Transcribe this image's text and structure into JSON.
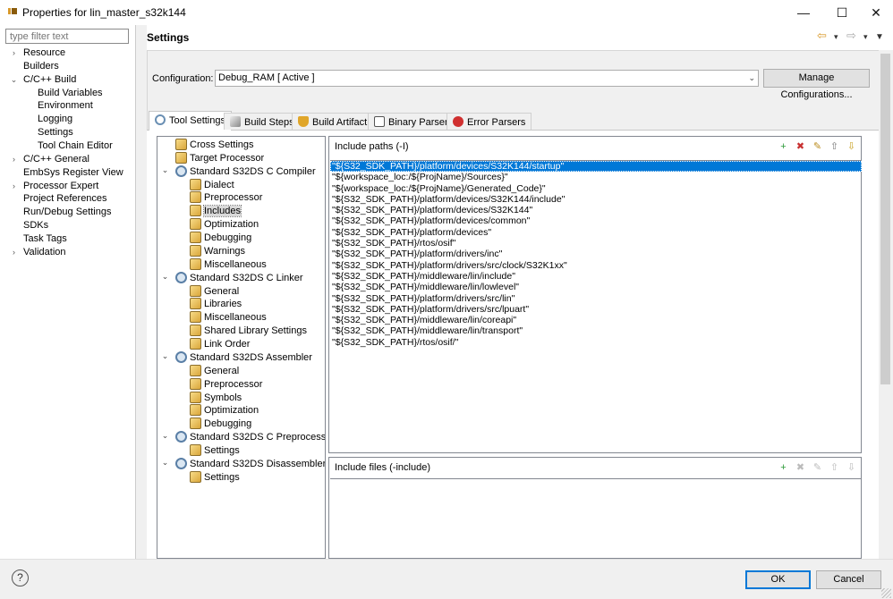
{
  "window": {
    "title": "Properties for lin_master_s32k144",
    "minimize": "—",
    "maximize": "☐",
    "close": "✕"
  },
  "filter": {
    "placeholder": "type filter text"
  },
  "nav": {
    "items": [
      {
        "label": "Resource",
        "expand": "›"
      },
      {
        "label": "Builders"
      },
      {
        "label": "C/C++ Build",
        "expand": "⌄"
      },
      {
        "label": "Build Variables"
      },
      {
        "label": "Environment"
      },
      {
        "label": "Logging"
      },
      {
        "label": "Settings"
      },
      {
        "label": "Tool Chain Editor"
      },
      {
        "label": "C/C++ General",
        "expand": "›"
      },
      {
        "label": "EmbSys Register View"
      },
      {
        "label": "Processor Expert",
        "expand": "›"
      },
      {
        "label": "Project References"
      },
      {
        "label": "Run/Debug Settings"
      },
      {
        "label": "SDKs"
      },
      {
        "label": "Task Tags"
      },
      {
        "label": "Validation",
        "expand": "›"
      }
    ]
  },
  "header": {
    "title": "Settings",
    "back": "⇦",
    "back_drop": "▾",
    "forward": "⇨",
    "forward_drop": "▾",
    "menu": "▼"
  },
  "config": {
    "label": "Configuration:",
    "value": "Debug_RAM  [ Active ]",
    "chevron": "⌄",
    "manage_label": "Manage Configurations..."
  },
  "tabs": [
    {
      "label": "Tool Settings",
      "icon_color": "#6a8fb3"
    },
    {
      "label": "Build Steps",
      "icon_color": "#7a7a7a"
    },
    {
      "label": "Build Artifact",
      "icon_color": "#e0a62a"
    },
    {
      "label": "Binary Parsers",
      "icon_color": "#555555"
    },
    {
      "label": "Error Parsers",
      "icon_color": "#d03030"
    }
  ],
  "tree": {
    "items": [
      {
        "label": "Cross Settings"
      },
      {
        "label": "Target Processor"
      },
      {
        "label": "Standard S32DS C Compiler",
        "expand": "⌄"
      },
      {
        "label": "Dialect"
      },
      {
        "label": "Preprocessor"
      },
      {
        "label": "Includes"
      },
      {
        "label": "Optimization"
      },
      {
        "label": "Debugging"
      },
      {
        "label": "Warnings"
      },
      {
        "label": "Miscellaneous"
      },
      {
        "label": "Standard S32DS C Linker",
        "expand": "⌄"
      },
      {
        "label": "General"
      },
      {
        "label": "Libraries"
      },
      {
        "label": "Miscellaneous"
      },
      {
        "label": "Shared Library Settings"
      },
      {
        "label": "Link Order"
      },
      {
        "label": "Standard S32DS Assembler",
        "expand": "⌄"
      },
      {
        "label": "General"
      },
      {
        "label": "Preprocessor"
      },
      {
        "label": "Symbols"
      },
      {
        "label": "Optimization"
      },
      {
        "label": "Debugging"
      },
      {
        "label": "Standard S32DS C Preprocessor",
        "expand": "⌄"
      },
      {
        "label": "Settings"
      },
      {
        "label": "Standard S32DS Disassembler",
        "expand": "⌄"
      },
      {
        "label": "Settings"
      }
    ]
  },
  "include_paths": {
    "title": "Include paths (-I)",
    "items": [
      "\"${S32_SDK_PATH}/platform/devices/S32K144/startup\"",
      "\"${workspace_loc:/${ProjName}/Sources}\"",
      "\"${workspace_loc:/${ProjName}/Generated_Code}\"",
      "\"${S32_SDK_PATH}/platform/devices/S32K144/include\"",
      "\"${S32_SDK_PATH}/platform/devices/S32K144\"",
      "\"${S32_SDK_PATH}/platform/devices/common\"",
      "\"${S32_SDK_PATH}/platform/devices\"",
      "\"${S32_SDK_PATH}/rtos/osif\"",
      "\"${S32_SDK_PATH}/platform/drivers/inc\"",
      "\"${S32_SDK_PATH}/platform/drivers/src/clock/S32K1xx\"",
      "\"${S32_SDK_PATH}/middleware/lin/include\"",
      "\"${S32_SDK_PATH}/middleware/lin/lowlevel\"",
      "\"${S32_SDK_PATH}/platform/drivers/src/lin\"",
      "\"${S32_SDK_PATH}/platform/drivers/src/lpuart\"",
      "\"${S32_SDK_PATH}/middleware/lin/coreapi\"",
      "\"${S32_SDK_PATH}/middleware/lin/transport\"",
      "\"${S32_SDK_PATH}/rtos/osif/\""
    ]
  },
  "include_files": {
    "title": "Include files (-include)"
  },
  "toolbar_icons": [
    "add-icon",
    "delete-icon",
    "edit-icon",
    "move-up-icon",
    "move-down-icon"
  ],
  "footer": {
    "help": "?",
    "ok_label": "OK",
    "cancel_label": "Cancel"
  }
}
